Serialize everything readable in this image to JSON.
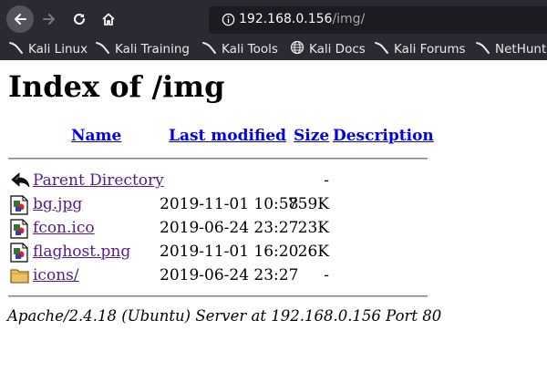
{
  "browser": {
    "url_host": "192.168.0.156",
    "url_path": "/img/",
    "bookmarks": [
      {
        "label": "Kali Linux",
        "icon": "kali-dragon-icon"
      },
      {
        "label": "Kali Training",
        "icon": "kali-dragon-icon"
      },
      {
        "label": "Kali Tools",
        "icon": "kali-dragon-icon"
      },
      {
        "label": "Kali Docs",
        "icon": "globe-icon"
      },
      {
        "label": "Kali Forums",
        "icon": "kali-dragon-icon"
      },
      {
        "label": "NetHunt",
        "icon": "kali-dragon-icon"
      }
    ]
  },
  "page": {
    "title": "Index of /img",
    "columns": {
      "name": "Name",
      "modified": "Last modified",
      "size": "Size",
      "description": "Description"
    },
    "rows": [
      {
        "name": "Parent Directory",
        "modified": "",
        "size": "-",
        "icon": "back-arrow-icon"
      },
      {
        "name": "bg.jpg",
        "modified": "2019-11-01 10:58",
        "size": "759K",
        "icon": "image-file-icon"
      },
      {
        "name": "fcon.ico",
        "modified": "2019-06-24 23:27",
        "size": "23K",
        "icon": "image-file-icon"
      },
      {
        "name": "flaghost.png",
        "modified": "2019-11-01 16:20",
        "size": "26K",
        "icon": "image-file-icon"
      },
      {
        "name": "icons/",
        "modified": "2019-06-24 23:27",
        "size": "-",
        "icon": "folder-icon"
      }
    ],
    "address": "Apache/2.4.18 (Ubuntu) Server at 192.168.0.156 Port 80"
  },
  "colors": {
    "toolbar_bg": "#2b2a33",
    "urlbar_bg": "#1c1b22",
    "link": "#0000ee",
    "visited_link": "#551a8b"
  }
}
